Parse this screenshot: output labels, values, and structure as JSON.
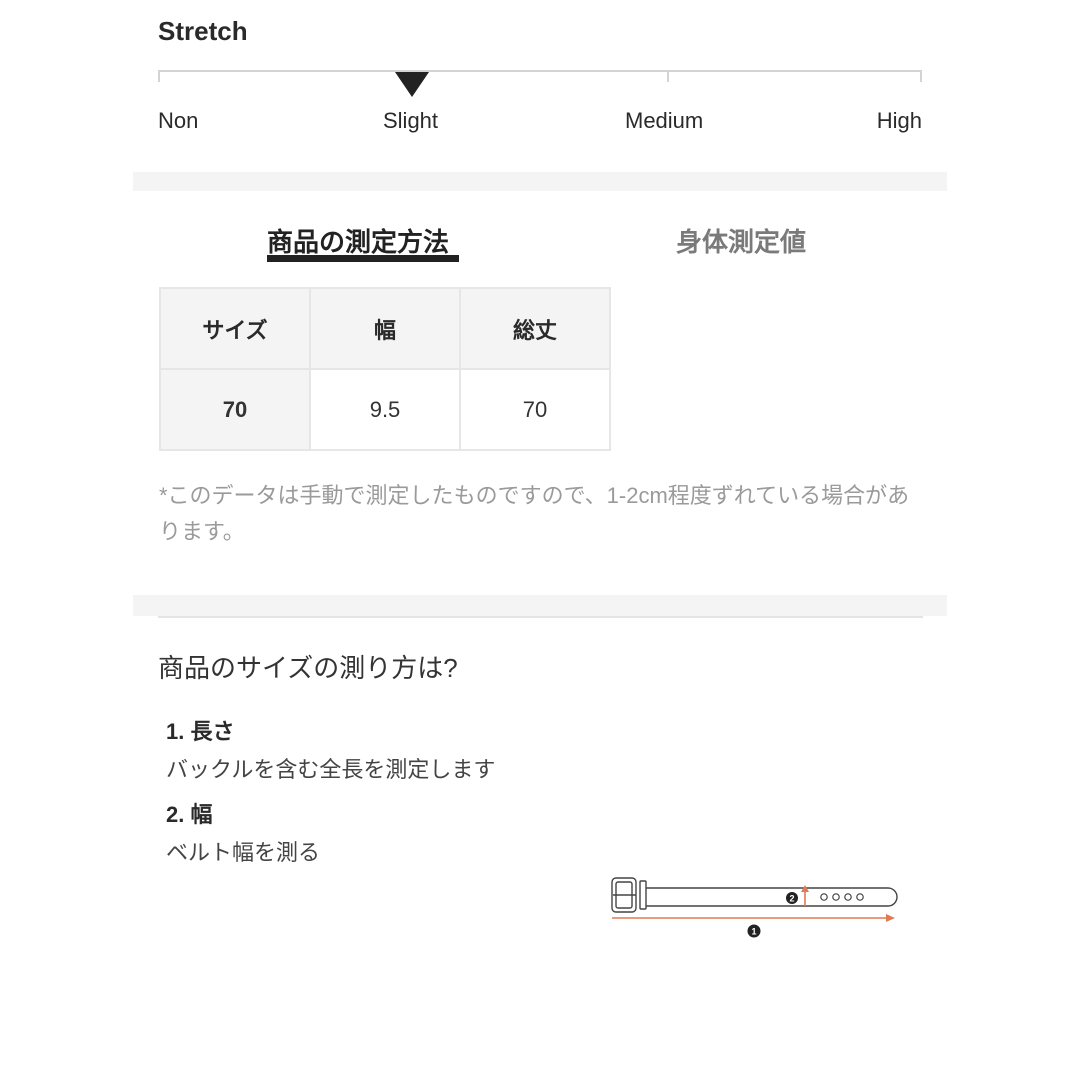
{
  "stretch": {
    "title": "Stretch",
    "levels": [
      "Non",
      "Slight",
      "Medium",
      "High"
    ],
    "selected_level": "Slight",
    "selected_fraction": 0.333
  },
  "tabs": [
    {
      "label": "商品の測定方法",
      "active": true
    },
    {
      "label": "身体測定値",
      "active": false
    }
  ],
  "size_table": {
    "headers": [
      "サイズ",
      "幅",
      "総丈"
    ],
    "rows": [
      [
        "70",
        "9.5",
        "70"
      ]
    ]
  },
  "note": "*このデータは手動で測定したものですので、1-2cm程度ずれている場合があります。",
  "howto": {
    "title": "商品のサイズの測り方は?",
    "steps": [
      {
        "title": "1. 長さ",
        "desc": "バックルを含む全長を測定します"
      },
      {
        "title": "2. 幅",
        "desc": "ベルト幅を測る"
      }
    ],
    "diagram": {
      "marker_1": "1",
      "marker_2": "2",
      "accent_color": "#e07a52"
    }
  }
}
